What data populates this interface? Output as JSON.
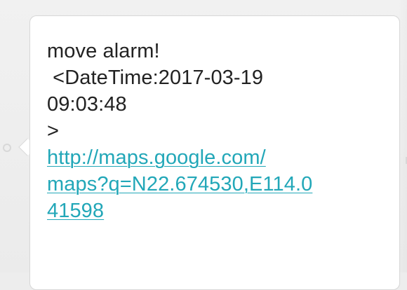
{
  "message": {
    "lines": [
      "move alarm!",
      " <DateTime:2017-03-19",
      "09:03:48",
      ">"
    ],
    "link_lines": [
      "http://maps.google.com/",
      "maps?q=N22.674530,E114.0",
      "41598"
    ]
  },
  "colors": {
    "text": "#222222",
    "link": "#22a7b8",
    "bubble": "#ffffff",
    "background": "#ededed"
  }
}
